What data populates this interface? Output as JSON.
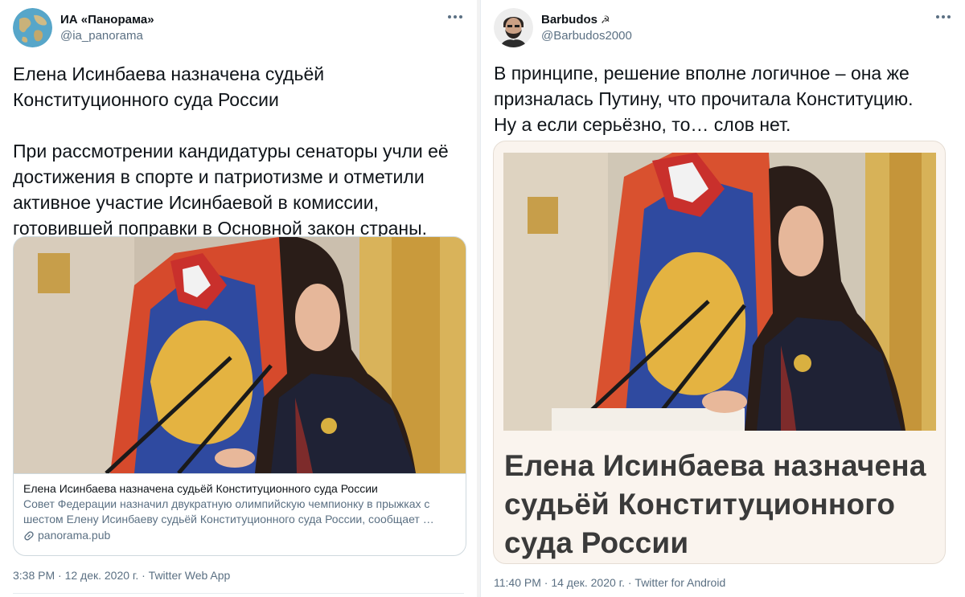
{
  "left_tweet": {
    "author_name": "ИА «Панорама»",
    "handle": "@ia_panorama",
    "avatar_icon": "globe-avatar",
    "text": "Елена Исинбаева назначена судьёй\nКонституционного суда России\n\nПри рассмотрении кандидатуры сенаторы учли её\nдостижения в спорте и патриотизме и отметили\nактивное участие Исинбаевой в комиссии,\nготовившей поправки в Основной закон страны.",
    "card": {
      "title": "Елена Исинбаева назначена судьёй Конституционного суда России",
      "description": "Совет Федерации назначил двукратную олимпийскую чемпионку в прыжках с шестом Елену Исинбаеву судьёй Конституционного суда России, сообщает …",
      "link": "panorama.pub",
      "link_icon": "link-icon"
    },
    "timestamp": "3:38 PM · 12 дек. 2020 г. · Twitter Web App"
  },
  "right_tweet": {
    "author_name": "Barbudos",
    "name_emoji": "☭",
    "handle": "@Barbudos2000",
    "avatar_icon": "bearded-man-avatar",
    "text": "В принципе, решение вполне логичное – она же\nпризналась Путину, что прочитала Конституцию.\nНу а если серьёзно, то… слов нет.",
    "card": {
      "headline": "Елена Исинбаева назначена\nсудьёй Конституционного\nсуда России"
    },
    "timestamp": "11:40 PM · 14 дек. 2020 г. · Twitter for Android"
  },
  "colors": {
    "text": "#0f1419",
    "secondary": "#5b7083",
    "border": "#cfd9de",
    "headline": "#3a3a3a",
    "card_bg": "#faf4ee"
  }
}
